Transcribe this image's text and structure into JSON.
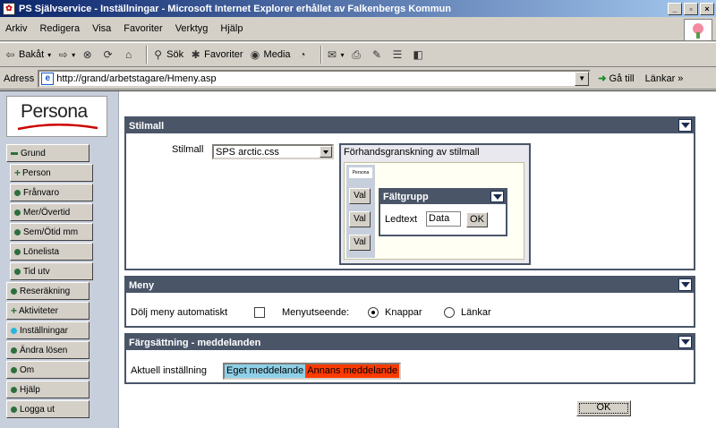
{
  "window": {
    "title": "PS Självservice - Inställningar - Microsoft Internet Explorer erhållet av Falkenbergs Kommun",
    "controls": [
      "_",
      "▫",
      "×"
    ]
  },
  "menubar": {
    "items": [
      "Arkiv",
      "Redigera",
      "Visa",
      "Favoriter",
      "Verktyg",
      "Hjälp"
    ]
  },
  "toolbar": {
    "back": "Bakåt",
    "search": "Sök",
    "favorites": "Favoriter",
    "media": "Media"
  },
  "address": {
    "label": "Adress",
    "url": "http://grand/arbetstagare/Hmeny.asp",
    "go": "Gå till",
    "links": "Länkar"
  },
  "nav": {
    "logo_text": "Persona",
    "items": [
      {
        "label": "Grund",
        "marker": "minus"
      },
      {
        "label": "Person",
        "marker": "plus"
      },
      {
        "label": "Frånvaro",
        "marker": "dot"
      },
      {
        "label": "Mer/Övertid",
        "marker": "dot"
      },
      {
        "label": "Sem/Ötid mm",
        "marker": "dot"
      },
      {
        "label": "Lönelista",
        "marker": "dot"
      },
      {
        "label": "Tid utv",
        "marker": "dot"
      },
      {
        "label": "Reseräkning",
        "marker": "dot"
      },
      {
        "label": "Aktiviteter",
        "marker": "plus"
      },
      {
        "label": "Inställningar",
        "marker": "dot-cyan"
      },
      {
        "label": "Ändra lösen",
        "marker": "dot"
      },
      {
        "label": "Om",
        "marker": "dot"
      },
      {
        "label": "Hjälp",
        "marker": "dot"
      },
      {
        "label": "Logga ut",
        "marker": "dot"
      }
    ]
  },
  "stilmall": {
    "header": "Stilmall",
    "field_label": "Stilmall",
    "selected": "SPS arctic.css",
    "preview_title": "Förhandsgranskning av stilmall",
    "preview_logo": "Persona",
    "preview_buttons": [
      "Val",
      "Val",
      "Val"
    ],
    "preview_group": "Fältgrupp",
    "preview_field_label": "Ledtext",
    "preview_field_value": "Data",
    "preview_ok": "OK"
  },
  "meny": {
    "header": "Meny",
    "hide_label": "Dölj meny automatiskt",
    "hide_checked": false,
    "appearance_label": "Menyutseende:",
    "option_buttons": "Knappar",
    "option_links": "Länkar",
    "selected": "Knappar"
  },
  "farg": {
    "header": "Färgsättning - meddelanden",
    "current_label": "Aktuell inställning",
    "own_msg": "Eget meddelande",
    "other_msg": "Annans meddelande",
    "own_color": "#8ed0e8",
    "other_color": "#ff3a00"
  },
  "footer": {
    "ok": "OK"
  }
}
